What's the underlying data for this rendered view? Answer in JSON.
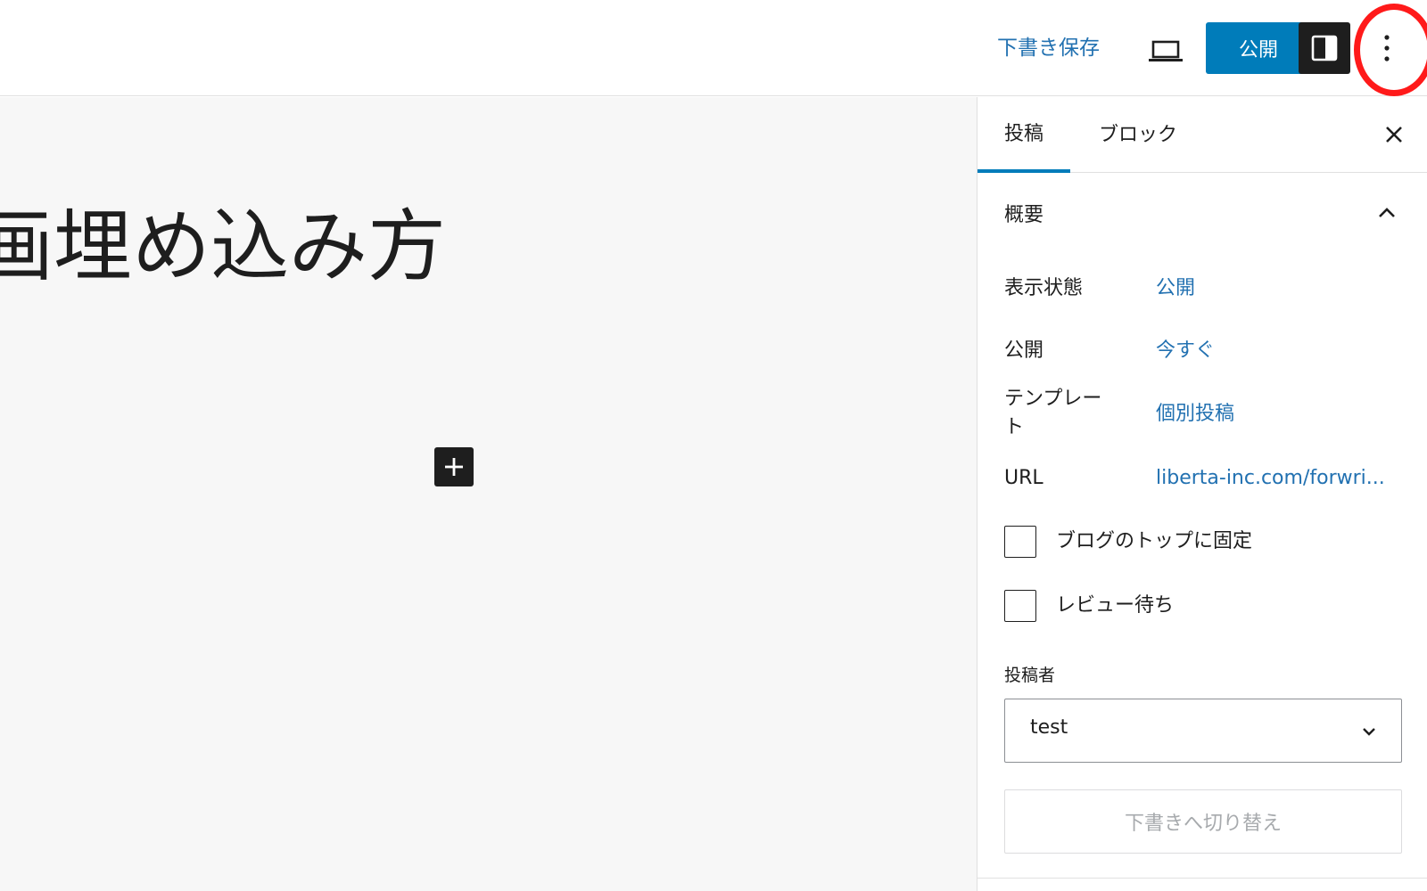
{
  "toolbar": {
    "save_draft_label": "下書き保存",
    "preview_icon": "laptop-icon",
    "publish_label": "公開",
    "settings_icon": "sidebar-toggle-icon",
    "more_icon": "vertical-ellipsis-icon",
    "highlight_color": "#ff1a1a"
  },
  "editor": {
    "title_text": "画埋め込み方",
    "inserter_icon": "plus-icon"
  },
  "sidebar": {
    "tabs": [
      {
        "label": "投稿",
        "active": true
      },
      {
        "label": "ブロック",
        "active": false
      }
    ],
    "close_icon": "close-icon",
    "summary": {
      "title": "概要",
      "chevron_icon": "chevron-up-icon",
      "rows": [
        {
          "label": "表示状態",
          "value": "公開"
        },
        {
          "label": "公開",
          "value": "今すぐ"
        },
        {
          "label": "テンプレート",
          "value": "個別投稿"
        },
        {
          "label": "URL",
          "value": "liberta-inc.com/forwri..."
        }
      ],
      "checkboxes": [
        {
          "label": "ブログのトップに固定",
          "checked": false
        },
        {
          "label": "レビュー待ち",
          "checked": false
        }
      ],
      "author": {
        "label": "投稿者",
        "value": "test",
        "chevron_icon": "chevron-down-icon"
      },
      "switch_draft_label": "下書きへ切り替え"
    }
  },
  "colors": {
    "accent": "#007cba",
    "link": "#2271b1",
    "dark": "#1e1e1e",
    "canvas_bg": "#f7f7f7"
  }
}
